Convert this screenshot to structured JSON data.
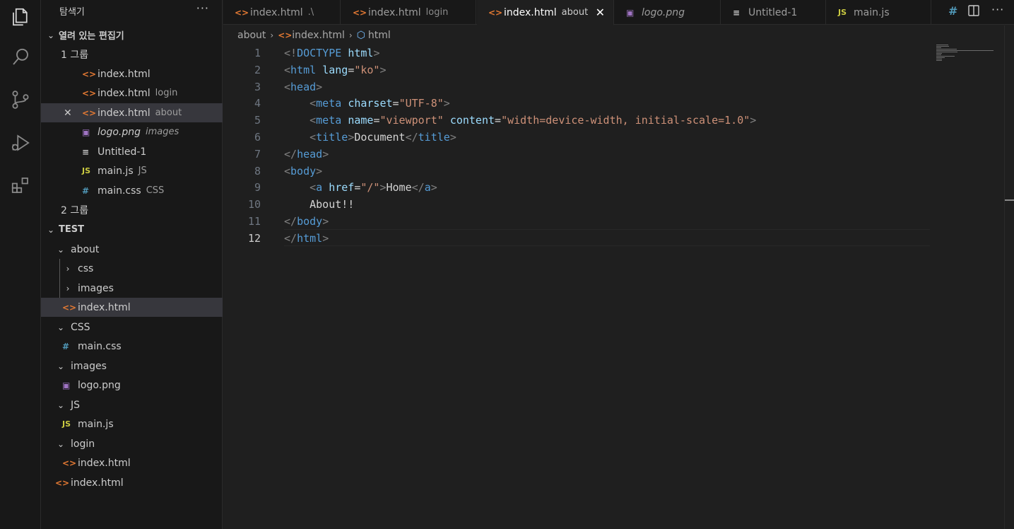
{
  "activity_bar": {
    "items": [
      {
        "icon": "explorer-icon"
      },
      {
        "icon": "search-icon"
      },
      {
        "icon": "source-control-icon"
      },
      {
        "icon": "run-debug-icon"
      },
      {
        "icon": "extensions-icon"
      }
    ]
  },
  "sidebar": {
    "title": "탐색기",
    "more": "···",
    "open_editors": {
      "title": "열려 있는 편집기",
      "group1_label": "1 그룹",
      "group2_label": "2 그룹",
      "items": [
        {
          "icon": "<>",
          "name": "index.html",
          "desc": ""
        },
        {
          "icon": "<>",
          "name": "index.html",
          "desc": "login"
        },
        {
          "icon": "<>",
          "name": "index.html",
          "desc": "about",
          "close": "✕"
        },
        {
          "icon": "▣",
          "name": "logo.png",
          "desc": "images"
        },
        {
          "icon": "≡",
          "name": "Untitled-1",
          "desc": ""
        },
        {
          "icon": "JS",
          "name": "main.js",
          "desc": "JS"
        },
        {
          "icon": "#",
          "name": "main.css",
          "desc": "CSS"
        }
      ]
    },
    "folder": {
      "title": "TEST",
      "items": [
        {
          "label": "about",
          "icon": ""
        },
        {
          "label": "css",
          "icon": ""
        },
        {
          "label": "images",
          "icon": ""
        },
        {
          "label": "index.html",
          "icon": "<>"
        },
        {
          "label": "CSS",
          "icon": ""
        },
        {
          "label": "main.css",
          "icon": "#"
        },
        {
          "label": "images",
          "icon": ""
        },
        {
          "label": "logo.png",
          "icon": "▣"
        },
        {
          "label": "JS",
          "icon": ""
        },
        {
          "label": "main.js",
          "icon": "JS"
        },
        {
          "label": "login",
          "icon": ""
        },
        {
          "label": "index.html",
          "icon": "<>"
        },
        {
          "label": "index.html",
          "icon": "<>"
        }
      ]
    }
  },
  "tabs": [
    {
      "icon": "<>",
      "name": "index.html",
      "desc": ".\\"
    },
    {
      "icon": "<>",
      "name": "index.html",
      "desc": "login"
    },
    {
      "icon": "<>",
      "name": "index.html",
      "desc": "about",
      "close": "✕"
    },
    {
      "icon": "▣",
      "name": "logo.png",
      "desc": ""
    },
    {
      "icon": "≡",
      "name": "Untitled-1",
      "desc": ""
    },
    {
      "icon": "JS",
      "name": "main.js",
      "desc": ""
    }
  ],
  "tab_actions": {
    "hash": "#"
  },
  "breadcrumb": {
    "folder": "about",
    "file": "index.html",
    "symbol": "html"
  },
  "editor": {
    "line_numbers": [
      "1",
      "2",
      "3",
      "4",
      "5",
      "6",
      "7",
      "8",
      "9",
      "10",
      "11",
      "12"
    ],
    "current_line": 12,
    "lines": [
      [
        {
          "t": "br",
          "v": "<!"
        },
        {
          "t": "tag",
          "v": "DOCTYPE"
        },
        {
          "t": "txt",
          "v": " "
        },
        {
          "t": "at",
          "v": "html"
        },
        {
          "t": "br",
          "v": ">"
        }
      ],
      [
        {
          "t": "br",
          "v": "<"
        },
        {
          "t": "tag",
          "v": "html"
        },
        {
          "t": "txt",
          "v": " "
        },
        {
          "t": "at",
          "v": "lang"
        },
        {
          "t": "txt",
          "v": "="
        },
        {
          "t": "str",
          "v": "\"ko\""
        },
        {
          "t": "br",
          "v": ">"
        }
      ],
      [
        {
          "t": "br",
          "v": "<"
        },
        {
          "t": "tag",
          "v": "head"
        },
        {
          "t": "br",
          "v": ">"
        }
      ],
      [
        {
          "t": "txt",
          "v": "    "
        },
        {
          "t": "br",
          "v": "<"
        },
        {
          "t": "tag",
          "v": "meta"
        },
        {
          "t": "txt",
          "v": " "
        },
        {
          "t": "at",
          "v": "charset"
        },
        {
          "t": "txt",
          "v": "="
        },
        {
          "t": "str",
          "v": "\"UTF-8\""
        },
        {
          "t": "br",
          "v": ">"
        }
      ],
      [
        {
          "t": "txt",
          "v": "    "
        },
        {
          "t": "br",
          "v": "<"
        },
        {
          "t": "tag",
          "v": "meta"
        },
        {
          "t": "txt",
          "v": " "
        },
        {
          "t": "at",
          "v": "name"
        },
        {
          "t": "txt",
          "v": "="
        },
        {
          "t": "str",
          "v": "\"viewport\""
        },
        {
          "t": "txt",
          "v": " "
        },
        {
          "t": "at",
          "v": "content"
        },
        {
          "t": "txt",
          "v": "="
        },
        {
          "t": "str",
          "v": "\"width=device-width, initial-scale=1.0\""
        },
        {
          "t": "br",
          "v": ">"
        }
      ],
      [
        {
          "t": "txt",
          "v": "    "
        },
        {
          "t": "br",
          "v": "<"
        },
        {
          "t": "tag",
          "v": "title"
        },
        {
          "t": "br",
          "v": ">"
        },
        {
          "t": "txt",
          "v": "Document"
        },
        {
          "t": "br",
          "v": "</"
        },
        {
          "t": "tag",
          "v": "title"
        },
        {
          "t": "br",
          "v": ">"
        }
      ],
      [
        {
          "t": "br",
          "v": "</"
        },
        {
          "t": "tag",
          "v": "head"
        },
        {
          "t": "br",
          "v": ">"
        }
      ],
      [
        {
          "t": "br",
          "v": "<"
        },
        {
          "t": "tag",
          "v": "body"
        },
        {
          "t": "br",
          "v": ">"
        }
      ],
      [
        {
          "t": "txt",
          "v": "    "
        },
        {
          "t": "br",
          "v": "<"
        },
        {
          "t": "tag",
          "v": "a"
        },
        {
          "t": "txt",
          "v": " "
        },
        {
          "t": "at",
          "v": "href"
        },
        {
          "t": "txt",
          "v": "="
        },
        {
          "t": "str",
          "v": "\"/\""
        },
        {
          "t": "br",
          "v": ">"
        },
        {
          "t": "txt",
          "v": "Home"
        },
        {
          "t": "br",
          "v": "</"
        },
        {
          "t": "tag",
          "v": "a"
        },
        {
          "t": "br",
          "v": ">"
        }
      ],
      [
        {
          "t": "txt",
          "v": "    About!!"
        }
      ],
      [
        {
          "t": "br",
          "v": "</"
        },
        {
          "t": "tag",
          "v": "body"
        },
        {
          "t": "br",
          "v": ">"
        }
      ],
      [
        {
          "t": "br",
          "v": "</"
        },
        {
          "t": "tag",
          "v": "html"
        },
        {
          "t": "br",
          "v": ">"
        }
      ]
    ]
  },
  "colors": {
    "tag": "#569cd6",
    "attr": "#9cdcfe",
    "string": "#ce9178",
    "bracket": "#808080"
  }
}
